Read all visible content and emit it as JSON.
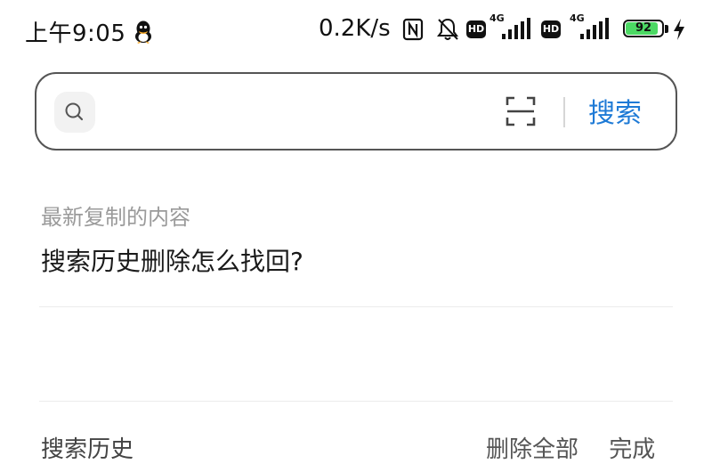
{
  "status_bar": {
    "time": "上午9:05",
    "net_speed": "0.2K/s",
    "hd_badge": "HD",
    "sim1_network": "4G",
    "sim2_network": "4G",
    "battery_level": "92",
    "icons": [
      "qq-icon",
      "nfc-icon",
      "bell-mute-icon",
      "signal-icon",
      "battery-icon",
      "charging-icon"
    ]
  },
  "search": {
    "value": "",
    "button_label": "搜索"
  },
  "clipboard": {
    "title": "最新复制的内容",
    "content": "搜索历史删除怎么找回?"
  },
  "history": {
    "title": "搜索历史",
    "delete_all_label": "删除全部",
    "done_label": "完成"
  },
  "colors": {
    "accent": "#1e7ad6",
    "battery_fill": "#4cd964"
  }
}
